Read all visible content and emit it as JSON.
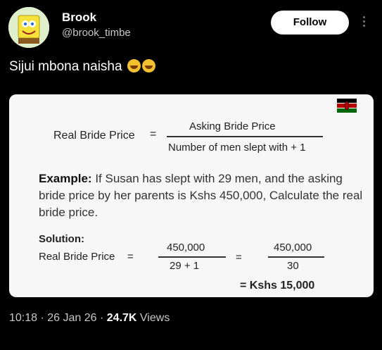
{
  "author": {
    "name": "Brook",
    "handle": "@brook_timbe"
  },
  "follow_label": "Follow",
  "tweet": {
    "text": "Sijui mbona naisha"
  },
  "image": {
    "formula_label": "Real Bride Price",
    "formula_eq": "=",
    "numerator": "Asking Bride Price",
    "denominator": "Number of men slept with + 1",
    "example_label": "Example:",
    "example_text": "If Susan has slept with 29 men, and the asking bride price by her parents is Kshs 450,000, Calculate the real bride price.",
    "solution_label": "Solution:",
    "solution_lhs": "Real Bride Price",
    "eq": "=",
    "frac1_num": "450,000",
    "frac1_den": "29 + 1",
    "frac2_num": "450,000",
    "frac2_den": "30",
    "final": "= Kshs 15,000"
  },
  "meta": {
    "time": "10:18",
    "date": "26 Jan 26",
    "views_count": "24.7K",
    "views_label": "Views"
  }
}
